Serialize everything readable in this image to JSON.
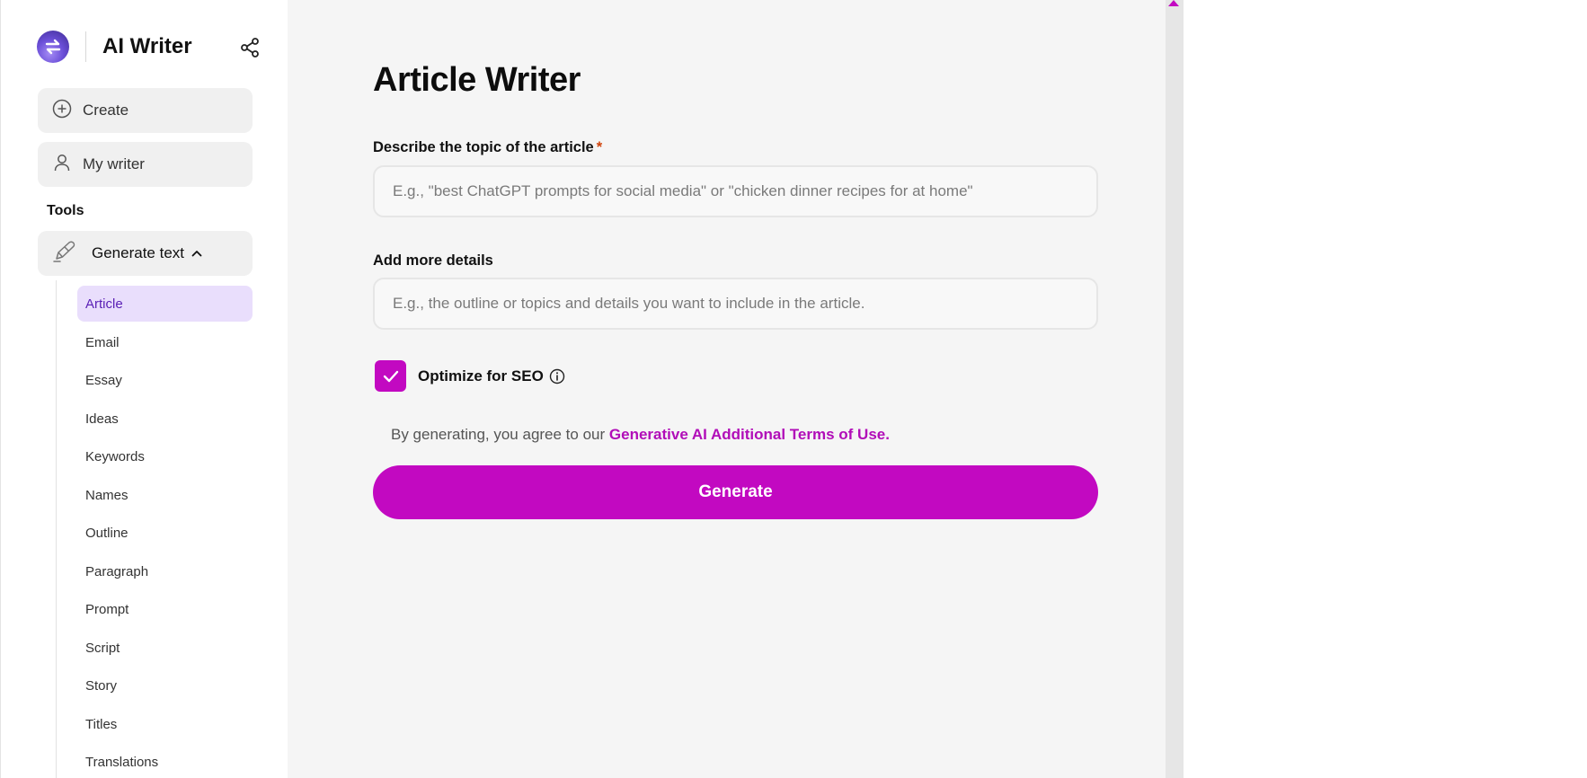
{
  "app": {
    "title": "AI Writer"
  },
  "sidebar": {
    "create_label": "Create",
    "my_writer_label": "My writer",
    "tools_label": "Tools",
    "generate_text_label": "Generate text",
    "items": [
      {
        "label": "Article",
        "active": true
      },
      {
        "label": "Email"
      },
      {
        "label": "Essay"
      },
      {
        "label": "Ideas"
      },
      {
        "label": "Keywords"
      },
      {
        "label": "Names"
      },
      {
        "label": "Outline"
      },
      {
        "label": "Paragraph"
      },
      {
        "label": "Prompt"
      },
      {
        "label": "Script"
      },
      {
        "label": "Story"
      },
      {
        "label": "Titles"
      },
      {
        "label": "Translations"
      }
    ]
  },
  "main": {
    "title": "Article Writer",
    "topic_label": "Describe the topic of the article",
    "required_mark": "*",
    "topic_placeholder": "E.g., \"best ChatGPT prompts for social media\" or \"chicken dinner recipes for at home\"",
    "topic_value": "",
    "details_label": "Add more details",
    "details_placeholder": "E.g., the outline or topics and details you want to include in the article.",
    "details_value": "",
    "seo_label": "Optimize for SEO",
    "seo_checked": true,
    "terms_prefix": "By generating, you agree to our",
    "terms_link": "Generative AI Additional Terms of Use.",
    "generate_label": "Generate"
  },
  "colors": {
    "accent": "#c209c1",
    "active_item_bg": "#e9defc",
    "active_item_text": "#5b21b6",
    "required": "#d0420a"
  },
  "icons": {
    "logo": "swap-arrows-logo",
    "share": "share-icon",
    "create": "plus-circle-icon",
    "my_writer": "user-icon",
    "generate_text": "pencil-icon",
    "chevron": "chevron-up-icon",
    "checkbox": "check-icon",
    "info": "info-icon"
  }
}
